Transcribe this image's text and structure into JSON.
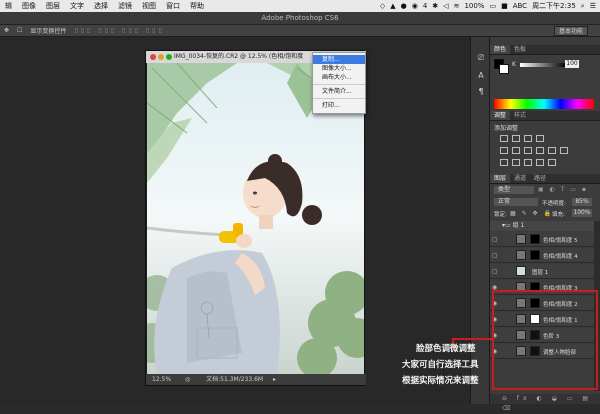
{
  "menubar": {
    "items": [
      "辑",
      "图像",
      "图层",
      "文字",
      "选择",
      "滤镜",
      "视图",
      "窗口",
      "帮助"
    ],
    "status": {
      "wifi": "",
      "battery": "100%",
      "input": "ABC",
      "clock": "周二下午2:35",
      "badge": "4"
    }
  },
  "app_title": "Adobe Photoshop CS6",
  "options_bar": {
    "show_transform": "显示变换控件",
    "workspace": "基本功能"
  },
  "document": {
    "title": "IMG_0034-恢复的.CR2 @ 12.5% (色相/饱和度",
    "zoom": "12.5%",
    "doc_size": "文档:51.3M/233.6M"
  },
  "context_menu": {
    "items": [
      "复制...",
      "图像大小...",
      "画布大小...",
      "文件简介...",
      "打印..."
    ],
    "selected_index": 0
  },
  "panels": {
    "color_tabs": [
      "颜色",
      "色板"
    ],
    "color_value": "100",
    "adjust_tabs": [
      "调整",
      "样式"
    ],
    "adjust_title": "添加调整",
    "layer_tabs": [
      "图层",
      "通道",
      "路径"
    ],
    "kind_label": "类型",
    "blend_mode": "正常",
    "opacity_label": "不透明度:",
    "opacity_value": "85%",
    "lock_label": "锁定:",
    "fill_label": "填充:",
    "fill_value": "100%",
    "group_name": "组 1",
    "layers": [
      {
        "name": "色相/饱和度 5"
      },
      {
        "name": "色相/饱和度 4"
      },
      {
        "name": "图层 1"
      },
      {
        "name": "色相/饱和度 3"
      },
      {
        "name": "色相/饱和度 2"
      },
      {
        "name": "色相/饱和度 1"
      },
      {
        "name": "色阶 3"
      },
      {
        "name": "调整人物脸部"
      }
    ]
  },
  "annotations": [
    "脸部色调微调整",
    "大家可自行选择工具",
    "根据实际情况来调整"
  ]
}
